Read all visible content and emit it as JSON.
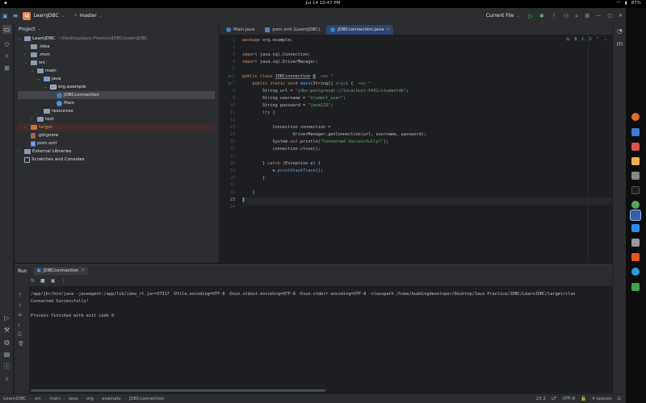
{
  "os": {
    "left_glyph": "⬥",
    "clock": "Jul 14  10:47 PM",
    "battery": "87%"
  },
  "toolbar": {
    "project_initials": "LJ",
    "project_name": "LearnJDBC",
    "branch": "master",
    "run_config": "Current File"
  },
  "project_panel": {
    "title": "Project",
    "tree": [
      {
        "label": "LearnJDBC",
        "path": "~/Desktop/Java Practice/JDBC/LearnJDBC",
        "depth": 0,
        "arrow": "⌄",
        "icon": "folder"
      },
      {
        "label": ".idea",
        "depth": 1,
        "arrow": "›",
        "icon": "folder"
      },
      {
        "label": ".mvn",
        "depth": 1,
        "arrow": "›",
        "icon": "folder"
      },
      {
        "label": "src",
        "depth": 1,
        "arrow": "⌄",
        "icon": "folder"
      },
      {
        "label": "main",
        "depth": 2,
        "arrow": "⌄",
        "icon": "folder"
      },
      {
        "label": "java",
        "depth": 3,
        "arrow": "⌄",
        "icon": "folder-src"
      },
      {
        "label": "org.example",
        "depth": 4,
        "arrow": "⌄",
        "icon": "package"
      },
      {
        "label": "JDBCconnection",
        "depth": 5,
        "arrow": "",
        "icon": "class",
        "selected": true
      },
      {
        "label": "Main",
        "depth": 5,
        "arrow": "",
        "icon": "class-main"
      },
      {
        "label": "resources",
        "depth": 3,
        "arrow": "",
        "icon": "folder"
      },
      {
        "label": "test",
        "depth": 2,
        "arrow": "›",
        "icon": "folder"
      },
      {
        "label": "target",
        "depth": 1,
        "arrow": "›",
        "icon": "folder-excluded",
        "highlight": true
      },
      {
        "label": ".gitignore",
        "depth": 1,
        "arrow": "",
        "icon": "file-git"
      },
      {
        "label": "pom.xml",
        "depth": 1,
        "arrow": "",
        "icon": "file-maven"
      },
      {
        "label": "External Libraries",
        "depth": 0,
        "arrow": "›",
        "icon": "library"
      },
      {
        "label": "Scratches and Consoles",
        "depth": 0,
        "arrow": "",
        "icon": "scratch"
      }
    ]
  },
  "editor": {
    "tabs": [
      {
        "label": "Main.java",
        "icon": "class",
        "active": false
      },
      {
        "label": "pom.xml (LearnJDBC)",
        "icon": "maven",
        "active": false
      },
      {
        "label": "JDBCconnection.java",
        "icon": "class",
        "active": true
      }
    ],
    "inspections": {
      "warnings": "3",
      "weak": "2"
    },
    "line_numbers": [
      "1",
      "2",
      "3",
      "4",
      "5",
      "6",
      "7",
      "8",
      "9",
      "10",
      "11",
      "12",
      "13",
      "14",
      "15",
      "16",
      "17",
      "18",
      "19",
      "20",
      "21",
      "22",
      "23",
      "24"
    ],
    "current_line": 23,
    "run_gutter_lines": [
      6,
      7
    ],
    "code": {
      "l1_kw": "package",
      "l1_rest": " org.example;",
      "l3_kw": "import",
      "l3_rest": " java.sql.Connection;",
      "l4_kw": "import",
      "l4_rest": " java.sql.DriverManager;",
      "l6_kw": "public class ",
      "l6_name": "JDBCconnection",
      "l6_brace": "{",
      "l6_hint": "new *",
      "l7_kw": "public static void ",
      "l7_fn": "main",
      "l7_args": "(String[] ",
      "l7_param": "args",
      "l7_end": ") {",
      "l7_hint": "new *",
      "l8_pre": "String url = ",
      "l8_str": "\"jdbc:postgresql://localhost:5432/studentdb\"",
      "l8_end": ";",
      "l9_pre": "String username = ",
      "l9_str": "\"student_user\"",
      "l9_end": ";",
      "l10_pre": "String password = ",
      "l10_str": "\"java123\"",
      "l10_end": ";",
      "l11_kw": "try",
      "l11_end": " {",
      "l13": "Connection connection =",
      "l14": "DriverManager.getConnection(url, username, password);",
      "l15_pre": "System.",
      "l15_st": "out",
      "l15_mid": ".println(",
      "l15_str": "\"Connected Successfully!\"",
      "l15_end": ");",
      "l16": "connection.close();",
      "l18_pre": "} ",
      "l18_kw": "catch",
      "l18_end": " (Exception e) {",
      "l19_pre": "e.",
      "l19_fn": "printStackTrace",
      "l19_end": "();",
      "l20": "}",
      "l22": "}",
      "l23": "}"
    }
  },
  "run_panel": {
    "title": "Run",
    "tab": "JDBCconnection",
    "console": [
      "/app/jbr/bin/java -javaagent:/app/lib/idea_rt.jar=37317 -Dfile.encoding=UTF-8 -Dsun.stdout.encoding=UTF-8 -Dsun.stderr.encoding=UTF-8 -classpath /home/buddingdeveloper/Desktop/Java Practice/JDBC/LearnJDBC/target/clas",
      "Connected Successfully!",
      "",
      "Process finished with exit code 0"
    ]
  },
  "status": {
    "crumbs": [
      "LearnJDBC",
      "src",
      "main",
      "java",
      "org",
      "example",
      "JDBCconnection"
    ],
    "position": "23:2",
    "line_ending": "LF",
    "encoding": "UTF-8",
    "indent": "4 spaces"
  },
  "colors": {
    "background": "#1e1f22",
    "panel": "#2b2d30",
    "active_tab": "#2e436e",
    "keyword": "#cf8e6d",
    "string": "#6aab73",
    "function": "#56a8f5"
  }
}
